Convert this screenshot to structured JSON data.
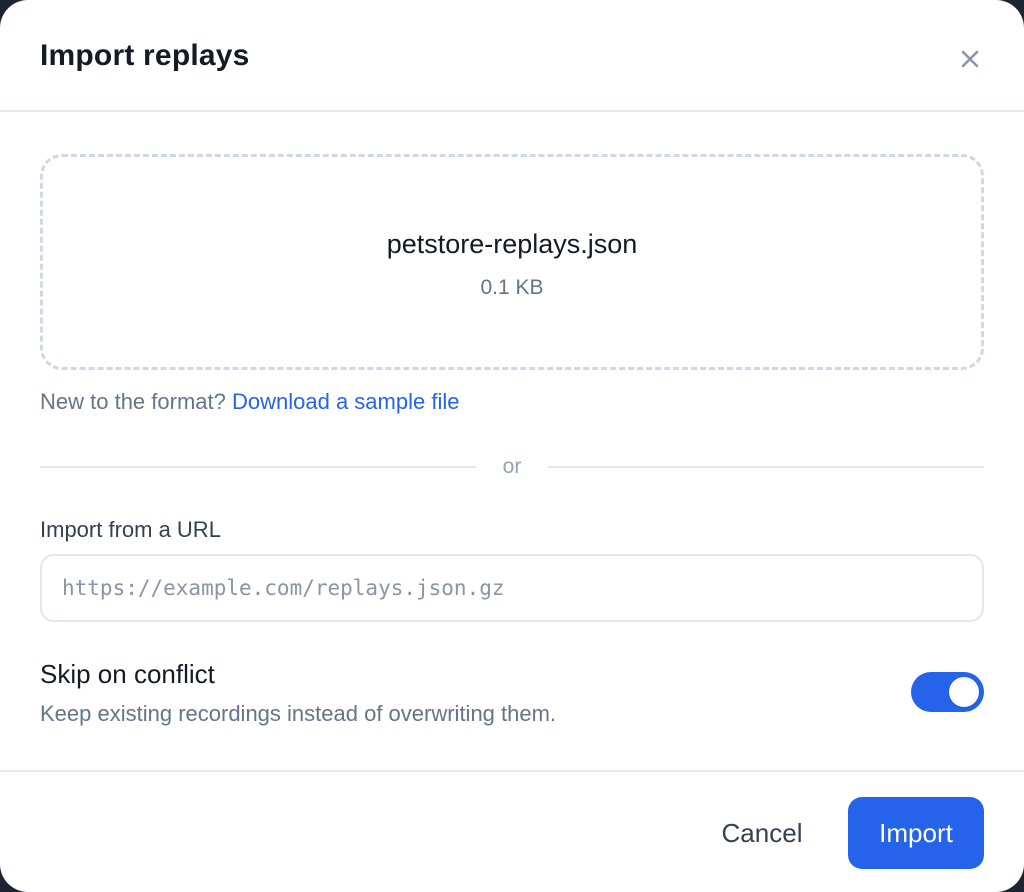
{
  "dialog": {
    "title": "Import replays",
    "close_icon": "close-icon"
  },
  "dropzone": {
    "file_name": "petstore-replays.json",
    "file_size": "0.1 KB"
  },
  "hint": {
    "text": "New to the format?",
    "link_label": "Download a sample file"
  },
  "divider": {
    "label": "or"
  },
  "url_import": {
    "label": "Import from a URL",
    "value": "",
    "placeholder": "https://example.com/replays.json.gz"
  },
  "skip_on_conflict": {
    "title": "Skip on conflict",
    "description": "Keep existing recordings instead of overwriting them.",
    "enabled": true
  },
  "footer": {
    "cancel_label": "Cancel",
    "import_label": "Import"
  },
  "colors": {
    "accent": "#2563eb",
    "toggle_off": "#cbd5e1"
  }
}
